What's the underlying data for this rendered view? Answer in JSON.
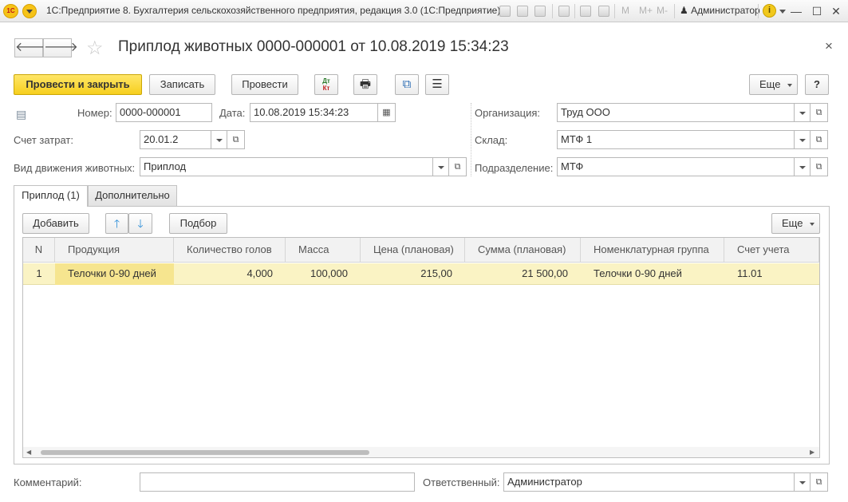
{
  "window": {
    "title": "1С:Предприятие 8. Бухгалтерия сельскохозяйственного предприятия, редакция 3.0  (1С:Предприятие)",
    "logo_text": "1С",
    "toolbar_m_labels": [
      "M",
      "M+",
      "M-"
    ],
    "user": "Администратор",
    "info_glyph": "i",
    "minimize_glyph": "—",
    "maximize_glyph": "☐",
    "close_glyph": "✕"
  },
  "form": {
    "back_glyph": "🡐",
    "forward_glyph": "🡒",
    "star_glyph": "☆",
    "title": "Приплод животных 0000-000001 от 10.08.2019 15:34:23",
    "close_glyph": "×"
  },
  "toolbar": {
    "post_and_close": "Провести и закрыть",
    "save": "Записать",
    "post": "Провести",
    "dt_label": "Дт",
    "kt_label": "Кт",
    "print_glyph": "🖶",
    "structure_glyph": "⧉",
    "list_glyph": "☰",
    "more": "Еще",
    "help": "?"
  },
  "fields": {
    "number_label": "Номер:",
    "number_value": "0000-000001",
    "date_label": "Дата:",
    "date_value": "10.08.2019 15:34:23",
    "calendar_glyph": "▦",
    "cost_account_label": "Счет затрат:",
    "cost_account_value": "20.01.2",
    "movement_label": "Вид движения животных:",
    "movement_value": "Приплод",
    "org_label": "Организация:",
    "org_value": "Труд ООО",
    "warehouse_label": "Склад:",
    "warehouse_value": "МТФ 1",
    "division_label": "Подразделение:",
    "division_value": "МТФ",
    "open_glyph": "⧉"
  },
  "tabs": [
    {
      "label": "Приплод (1)"
    },
    {
      "label": "Дополнительно"
    }
  ],
  "table_toolbar": {
    "add": "Добавить",
    "up_glyph": "🡑",
    "down_glyph": "🡓",
    "pick": "Подбор",
    "more": "Еще"
  },
  "table": {
    "columns": [
      "N",
      "Продукция",
      "Количество голов",
      "Масса",
      "Цена (плановая)",
      "Сумма (плановая)",
      "Номенклатурная группа",
      "Счет учета"
    ],
    "rows": [
      {
        "n": "1",
        "product": "Телочки 0-90 дней",
        "heads": "4,000",
        "mass": "100,000",
        "price": "215,00",
        "sum": "21 500,00",
        "group": "Телочки 0-90 дней",
        "account": "11.01"
      }
    ],
    "scroll_left_glyph": "◀",
    "scroll_right_glyph": "▶"
  },
  "footer": {
    "comment_label": "Комментарий:",
    "comment_value": "",
    "responsible_label": "Ответственный:",
    "responsible_value": "Администратор"
  },
  "colors": {
    "primary_button": "#f6cf1e",
    "selected_row": "#faf3c4",
    "selected_cell": "#f6e58f",
    "up_down_arrows": "#2f8fd8"
  }
}
